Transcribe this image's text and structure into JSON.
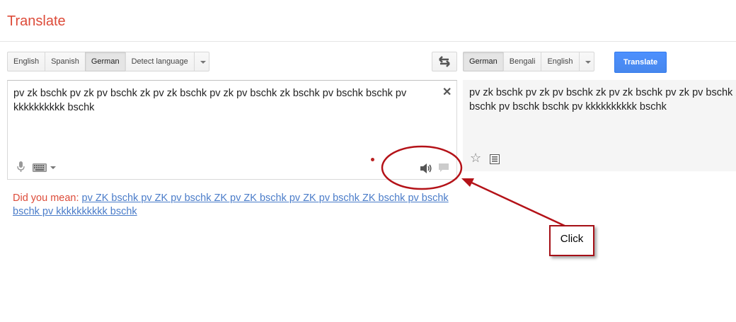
{
  "app": {
    "title": "Translate"
  },
  "source_languages": {
    "options": [
      "English",
      "Spanish",
      "German",
      "Detect language"
    ],
    "selected": "German"
  },
  "target_languages": {
    "options": [
      "German",
      "Bengali",
      "English"
    ],
    "selected": "German"
  },
  "translate_button": {
    "label": "Translate"
  },
  "source": {
    "text": "pv zk bschk pv zk pv bschk zk pv zk bschk pv zk pv bschk zk bschk pv bschk bschk pv kkkkkkkkkk bschk"
  },
  "result": {
    "text": "pv zk bschk pv zk pv bschk zk pv zk bschk pv zk pv bschk zk bschk pv bschk bschk pv kkkkkkkkkk bschk"
  },
  "did_you_mean": {
    "label": "Did you mean:",
    "suggestion": "pv ZK bschk pv ZK pv bschk ZK pv ZK bschk pv ZK pv bschk ZK bschk pv bschk bschk pv kkkkkkkkkk bschk"
  },
  "annotation": {
    "label": "Click",
    "color": "#b41218"
  },
  "colors": {
    "accent": "#dd4b39",
    "link": "#4a7cc9",
    "button_blue": "#4d90fe"
  }
}
